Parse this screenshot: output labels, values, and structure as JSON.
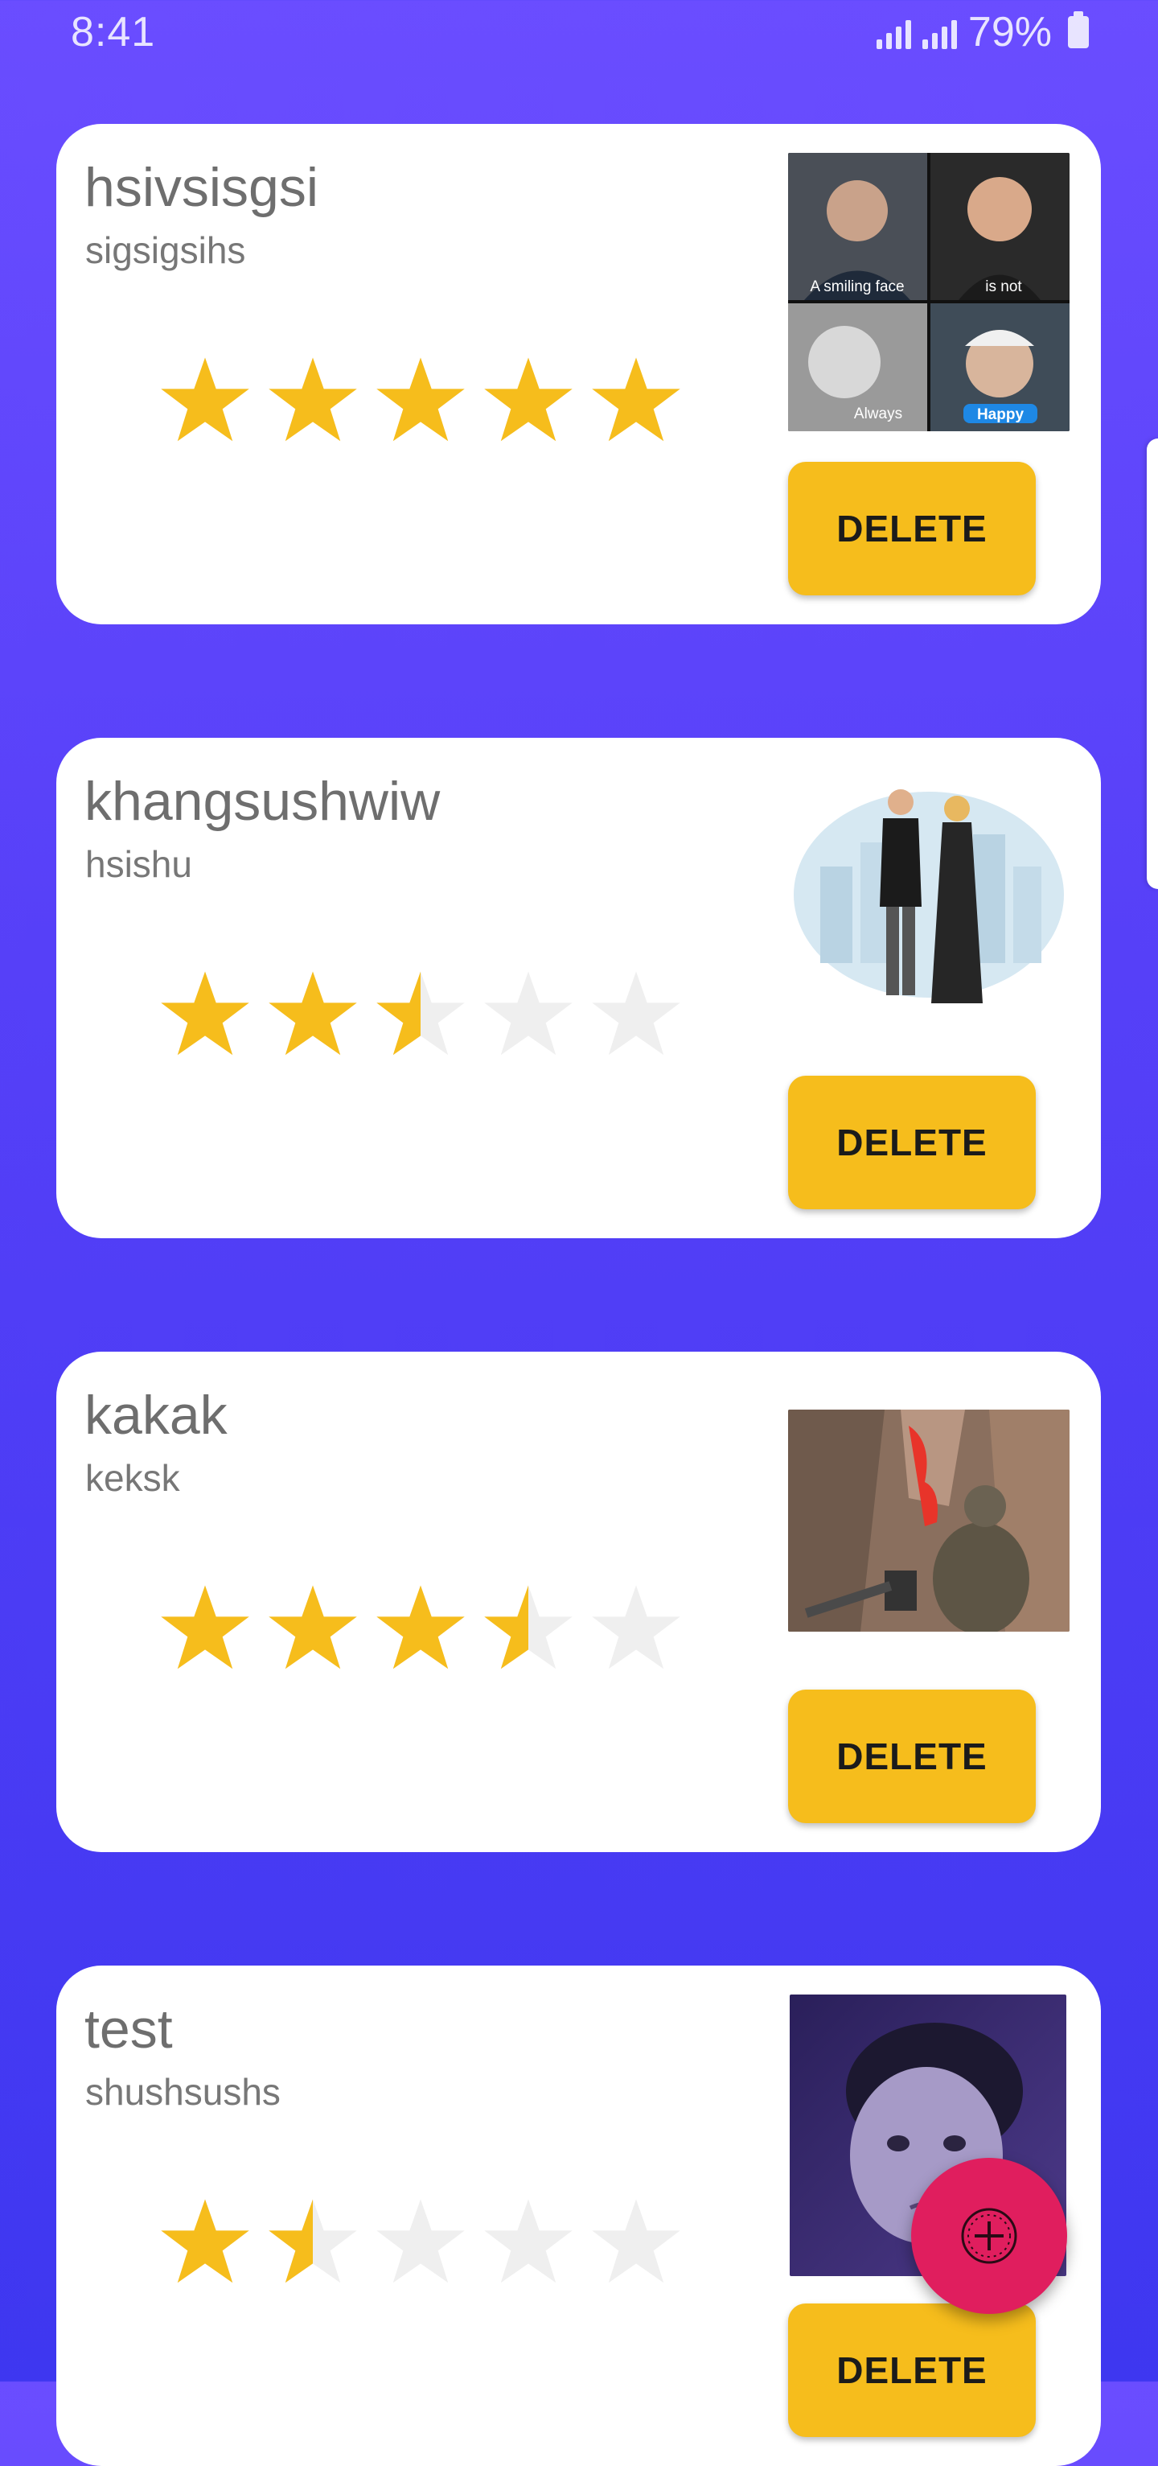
{
  "status_bar": {
    "time": "8:41",
    "battery": "79%"
  },
  "colors": {
    "accent": "#f6bd1c",
    "fab": "#e01e5e",
    "star_on": "#f6bd1c",
    "star_off": "#efefef"
  },
  "cards": [
    {
      "title": "hsivsisgsi",
      "subtitle": "sigsigsihs",
      "rating": 5,
      "delete_label": "DELETE",
      "image": {
        "type": "meme-grid",
        "captions": [
          "A smiling face",
          "is not",
          "Always",
          "Happy"
        ]
      }
    },
    {
      "title": "khangsushwiw",
      "subtitle": "hsishu",
      "rating": 2.5,
      "delete_label": "DELETE",
      "image": {
        "type": "illustration-couple"
      }
    },
    {
      "title": "kakak",
      "subtitle": "keksk",
      "rating": 3.5,
      "delete_label": "DELETE",
      "image": {
        "type": "photo-canyon"
      }
    },
    {
      "title": "test",
      "subtitle": "shushsushs",
      "rating": 1.5,
      "delete_label": "DELETE",
      "image": {
        "type": "photo-child"
      }
    }
  ],
  "fab": {
    "icon": "add-circle-icon"
  }
}
